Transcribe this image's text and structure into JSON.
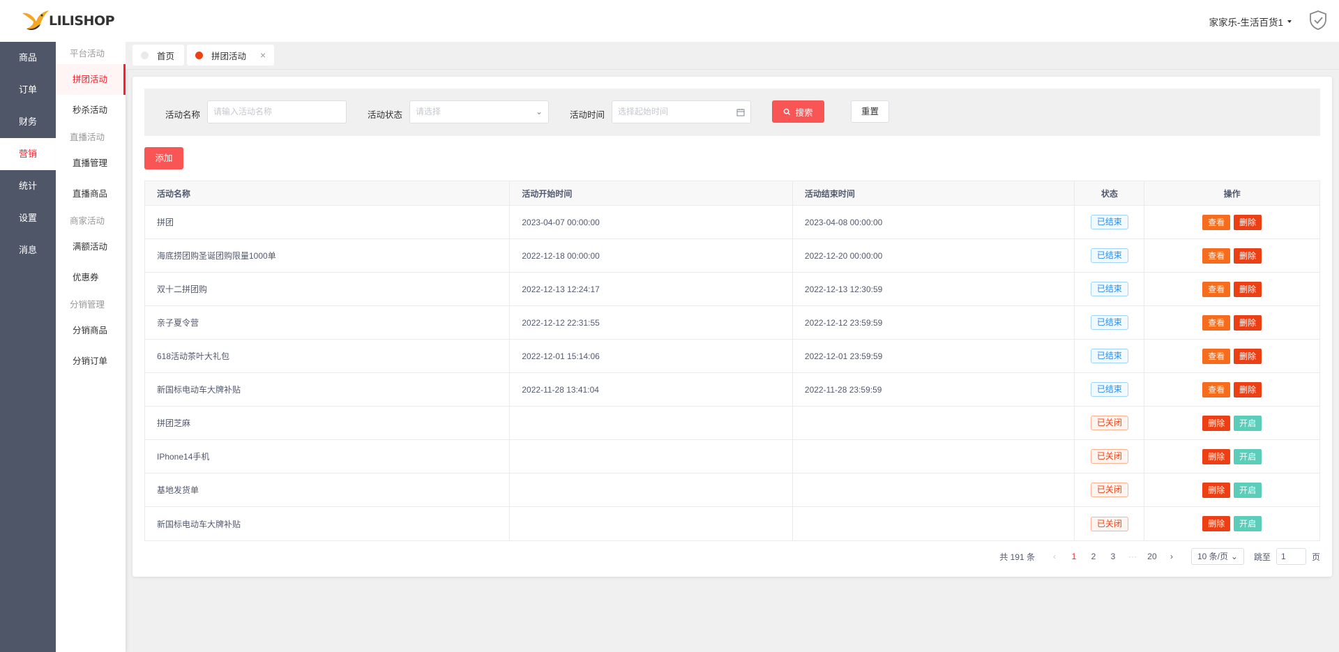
{
  "brand": {
    "name": "LILISHOP"
  },
  "nav1": {
    "items": [
      {
        "label": "商品"
      },
      {
        "label": "订单"
      },
      {
        "label": "财务"
      },
      {
        "label": "营销"
      },
      {
        "label": "统计"
      },
      {
        "label": "设置"
      },
      {
        "label": "消息"
      }
    ]
  },
  "nav2": {
    "group_platform": "平台活动",
    "item_group_buy": "拼团活动",
    "item_flash_sale": "秒杀活动",
    "group_live": "直播活动",
    "item_live_manage": "直播管理",
    "item_live_goods": "直播商品",
    "group_merchant": "商家活动",
    "item_full_discount": "满额活动",
    "item_coupon": "优惠券",
    "group_distribution": "分销管理",
    "item_dist_goods": "分销商品",
    "item_dist_orders": "分销订单"
  },
  "header": {
    "user": "家家乐-生活百货1"
  },
  "tabs": [
    {
      "label": "首页"
    },
    {
      "label": "拼团活动",
      "close": "×"
    }
  ],
  "search": {
    "name_label": "活动名称",
    "name_placeholder": "请输入活动名称",
    "status_label": "活动状态",
    "status_placeholder": "请选择",
    "time_label": "活动时间",
    "time_placeholder": "选择起始时间",
    "search_btn": "搜索",
    "reset_btn": "重置"
  },
  "add_btn": "添加",
  "table": {
    "headers": [
      "活动名称",
      "活动开始时间",
      "活动结束时间",
      "状态",
      "操作"
    ],
    "rows": [
      {
        "name": "拼团",
        "start": "2023-04-07 00:00:00",
        "end": "2023-04-08 00:00:00",
        "status": "已结束",
        "b1": "查看",
        "b2": "删除"
      },
      {
        "name": "海底捞团购圣诞团购限量1000单",
        "start": "2022-12-18 00:00:00",
        "end": "2022-12-20 00:00:00",
        "status": "已结束",
        "b1": "查看",
        "b2": "删除"
      },
      {
        "name": "双十二拼团购",
        "start": "2022-12-13 12:24:17",
        "end": "2022-12-13 12:30:59",
        "status": "已结束",
        "b1": "查看",
        "b2": "删除"
      },
      {
        "name": "亲子夏令营",
        "start": "2022-12-12 22:31:55",
        "end": "2022-12-12 23:59:59",
        "status": "已结束",
        "b1": "查看",
        "b2": "删除"
      },
      {
        "name": "618活动茶叶大礼包",
        "start": "2022-12-01 15:14:06",
        "end": "2022-12-01 23:59:59",
        "status": "已结束",
        "b1": "查看",
        "b2": "删除"
      },
      {
        "name": "新国标电动车大牌补贴",
        "start": "2022-11-28 13:41:04",
        "end": "2022-11-28 23:59:59",
        "status": "已结束",
        "b1": "查看",
        "b2": "删除"
      },
      {
        "name": "拼团芝麻",
        "start": "",
        "end": "",
        "status": "已关闭",
        "b1": "删除",
        "b2": "开启"
      },
      {
        "name": "IPhone14手机",
        "start": "",
        "end": "",
        "status": "已关闭",
        "b1": "删除",
        "b2": "开启"
      },
      {
        "name": "基地发货单",
        "start": "",
        "end": "",
        "status": "已关闭",
        "b1": "删除",
        "b2": "开启"
      },
      {
        "name": "新国标电动车大牌补贴",
        "start": "",
        "end": "",
        "status": "已关闭",
        "b1": "删除",
        "b2": "开启"
      }
    ]
  },
  "pagination": {
    "total": "共 191 条",
    "pages": [
      "1",
      "2",
      "3",
      "···",
      "20"
    ],
    "current": "1",
    "page_size": "10 条/页",
    "jump_label": "跳至",
    "jump_value": "1",
    "page_unit": "页"
  },
  "colors": {
    "accent": "#f95555",
    "nav_bg": "#4f5668",
    "view_btn": "#f56c1d",
    "delete_btn": "#ed3f14",
    "open_btn": "#5ccdb9"
  }
}
